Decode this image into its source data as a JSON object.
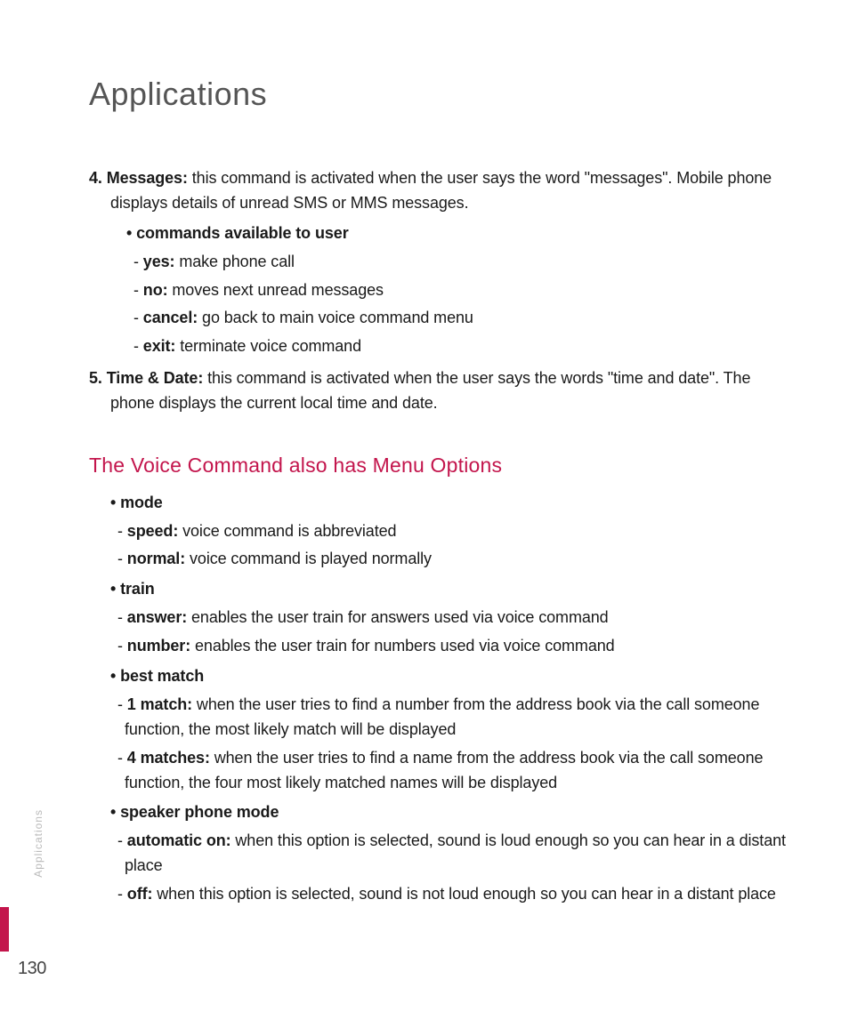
{
  "title": "Applications",
  "items": {
    "messages": {
      "num": "4. ",
      "label": "Messages:",
      "text": " this command is activated when the user says the word \"messages\". Mobile phone displays details of unread SMS or MMS messages.",
      "sub_heading": "commands available to user",
      "subs": {
        "yes": {
          "label": "yes:",
          "text": " make phone call"
        },
        "no": {
          "label": "no:",
          "text": " moves next unread messages"
        },
        "cancel": {
          "label": "cancel:",
          "text": " go back to main voice command menu"
        },
        "exit": {
          "label": "exit:",
          "text": " terminate voice command"
        }
      }
    },
    "timedate": {
      "num": "5. ",
      "label": "Time & Date:",
      "text": " this command is activated when the user says the words \"time and date\". The phone displays the current local time and date."
    }
  },
  "section_heading": "The Voice Command also has Menu Options",
  "menu": {
    "mode": {
      "label": "mode",
      "subs": {
        "speed": {
          "label": "speed:",
          "text": " voice command is abbreviated"
        },
        "normal": {
          "label": "normal:",
          "text": " voice command is played normally"
        }
      }
    },
    "train": {
      "label": "train",
      "subs": {
        "answer": {
          "label": "answer:",
          "text": " enables the user train for answers used via voice command"
        },
        "number": {
          "label": "number:",
          "text": " enables the user train for numbers used via voice command"
        }
      }
    },
    "bestmatch": {
      "label": "best match",
      "subs": {
        "one": {
          "label": "1 match:",
          "text": " when the user tries to find a number from the address book via the call someone function, the most likely match will be displayed"
        },
        "four": {
          "label": "4 matches:",
          "text": " when the user tries to find a name from the address book via the call someone function, the four most likely matched names will be displayed"
        }
      }
    },
    "speaker": {
      "label": "speaker phone mode",
      "subs": {
        "auto": {
          "label": "automatic on:",
          "text": " when this option is selected, sound is loud enough so you can hear in a distant place"
        },
        "off": {
          "label": "off:",
          "text": " when this option is selected, sound is not loud enough so you can hear in a distant place"
        }
      }
    }
  },
  "side_label": "Applications",
  "page_number": "130"
}
